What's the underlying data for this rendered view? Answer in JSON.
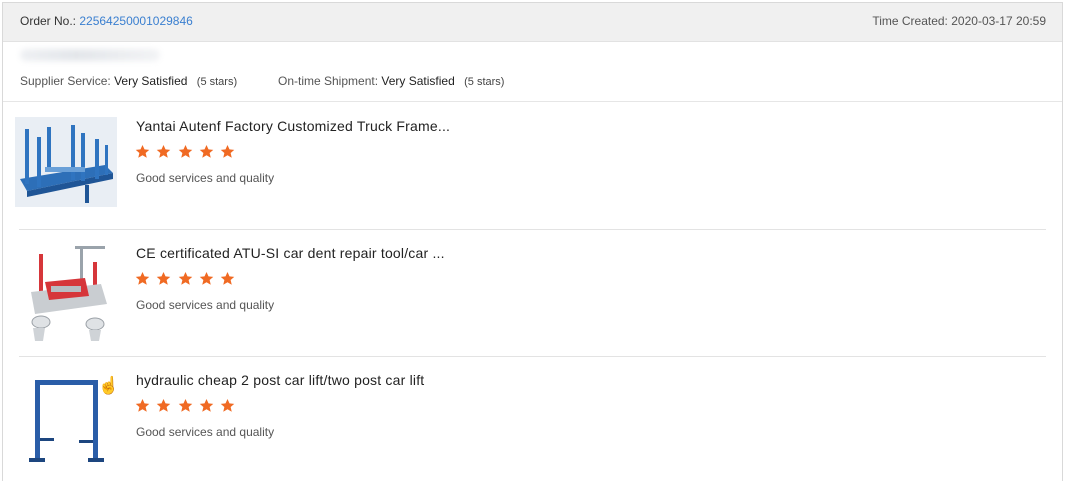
{
  "header": {
    "order_label": "Order No.:",
    "order_number": "22564250001029846",
    "time_label": "Time Created:",
    "time_value": "2020-03-17 20:59"
  },
  "ratings": {
    "supplier_label": "Supplier Service:",
    "supplier_value": "Very Satisfied",
    "supplier_stars": "(5 stars)",
    "shipment_label": "On-time Shipment:",
    "shipment_value": "Very Satisfied",
    "shipment_stars": "(5 stars)"
  },
  "colors": {
    "star": "#f06a23",
    "link": "#3a7fd0",
    "header_bg": "#f0f0f0"
  },
  "items": [
    {
      "title": "Yantai Autenf Factory Customized Truck Frame...",
      "rating": 5,
      "comment": "Good services and quality",
      "image": "truck-frame-machine"
    },
    {
      "title": "CE certificated ATU-SI car dent repair tool/car ...",
      "rating": 5,
      "comment": "Good services and quality",
      "image": "car-bench-repair-tool"
    },
    {
      "title": "hydraulic cheap 2 post car lift/two post car lift",
      "rating": 5,
      "comment": "Good services and quality",
      "image": "two-post-car-lift"
    }
  ]
}
